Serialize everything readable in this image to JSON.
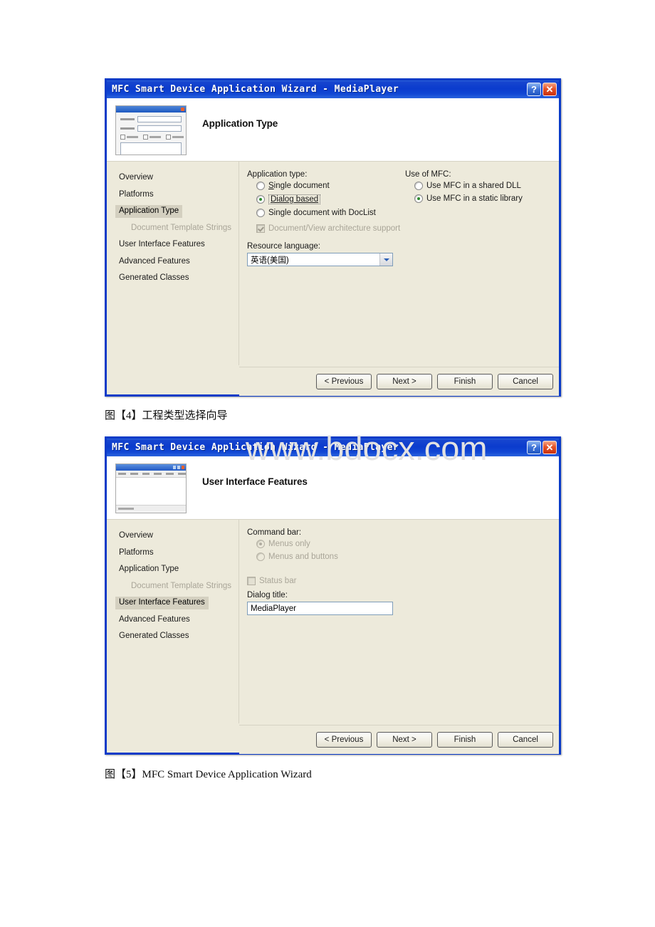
{
  "page": {
    "watermark": "www.bdocx.com"
  },
  "dialog1": {
    "titlebar": {
      "title": "MFC Smart Device Application Wizard - MediaPlayer",
      "help_label": "?",
      "close_label": "✕"
    },
    "header_title": "Application Type",
    "sidebar": {
      "items": [
        {
          "label": "Overview",
          "state": "normal"
        },
        {
          "label": "Platforms",
          "state": "normal"
        },
        {
          "label": "Application Type",
          "state": "active"
        },
        {
          "label": "Document Template Strings",
          "state": "disabled"
        },
        {
          "label": "User Interface Features",
          "state": "normal"
        },
        {
          "label": "Advanced Features",
          "state": "normal"
        },
        {
          "label": "Generated Classes",
          "state": "normal"
        }
      ]
    },
    "main": {
      "app_type_group_label": "Application type:",
      "app_type_options": [
        {
          "label": "Single document",
          "checked": false,
          "disabled": false,
          "focused": false
        },
        {
          "label": "Dialog based",
          "checked": true,
          "disabled": false,
          "focused": true
        },
        {
          "label": "Single document with DocList",
          "checked": false,
          "disabled": false,
          "focused": false
        }
      ],
      "docview_checkbox": {
        "label": "Document/View architecture support",
        "checked": true,
        "disabled": true
      },
      "resource_language_label": "Resource language:",
      "resource_language_value": "英语(美国)",
      "use_mfc_group_label": "Use of MFC:",
      "use_mfc_options": [
        {
          "label": "Use MFC in a shared DLL",
          "checked": false
        },
        {
          "label": "Use MFC in a static library",
          "checked": true
        }
      ]
    },
    "footer": {
      "previous": "< Previous",
      "next": "Next >",
      "finish": "Finish",
      "cancel": "Cancel"
    }
  },
  "caption1": "图【4】工程类型选择向导",
  "dialog2": {
    "titlebar": {
      "title": "MFC Smart Device Application Wizard - MediaPlayer",
      "help_label": "?",
      "close_label": "✕"
    },
    "header_title": "User Interface Features",
    "sidebar": {
      "items": [
        {
          "label": "Overview",
          "state": "normal"
        },
        {
          "label": "Platforms",
          "state": "normal"
        },
        {
          "label": "Application Type",
          "state": "normal"
        },
        {
          "label": "Document Template Strings",
          "state": "disabled"
        },
        {
          "label": "User Interface Features",
          "state": "active"
        },
        {
          "label": "Advanced Features",
          "state": "normal"
        },
        {
          "label": "Generated Classes",
          "state": "normal"
        }
      ]
    },
    "main": {
      "command_bar_group_label": "Command bar:",
      "command_bar_options": [
        {
          "label": "Menus only",
          "checked": true,
          "disabled": true
        },
        {
          "label": "Menus and buttons",
          "checked": false,
          "disabled": true
        }
      ],
      "status_bar_checkbox": {
        "label": "Status bar",
        "checked": false,
        "disabled": true
      },
      "dialog_title_label": "Dialog title:",
      "dialog_title_value": "MediaPlayer"
    },
    "footer": {
      "previous": "< Previous",
      "next": "Next >",
      "finish": "Finish",
      "cancel": "Cancel"
    }
  },
  "caption2": "图【5】MFC Smart Device Application Wizard"
}
